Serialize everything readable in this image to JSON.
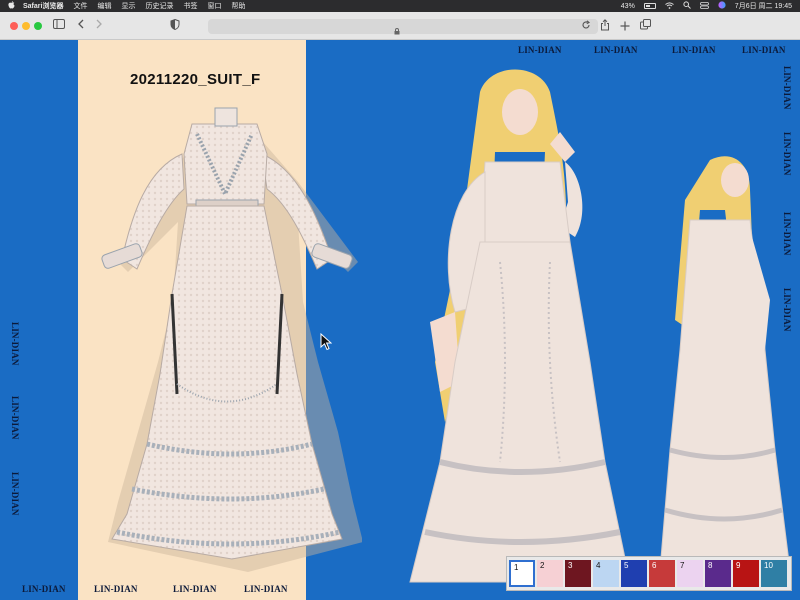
{
  "menubar": {
    "app_name": "Safari浏览器",
    "items": [
      "文件",
      "编辑",
      "显示",
      "历史记录",
      "书签",
      "窗口",
      "帮助"
    ],
    "battery": "43%",
    "datetime": "7月6日 周二 19:45",
    "icons": [
      "apple-icon",
      "battery-icon",
      "wifi-icon",
      "search-icon",
      "control-center-icon",
      "siri-icon"
    ]
  },
  "toolbar": {
    "icons": [
      "sidebar-icon",
      "back-icon",
      "forward-icon",
      "shield-icon",
      "lock-icon",
      "reload-icon",
      "share-icon",
      "new-tab-icon",
      "tabs-icon"
    ]
  },
  "content": {
    "suit_title": "20211220_SUIT_F",
    "watermark": "LIN-DIAN",
    "swatches": [
      {
        "label": "1",
        "color": "#ffffff"
      },
      {
        "label": "2",
        "color": "#f6d0d4"
      },
      {
        "label": "3",
        "color": "#6e1620"
      },
      {
        "label": "4",
        "color": "#bcd6f2"
      },
      {
        "label": "5",
        "color": "#1f3fb0"
      },
      {
        "label": "6",
        "color": "#c63a3a"
      },
      {
        "label": "7",
        "color": "#ecd3f0"
      },
      {
        "label": "8",
        "color": "#5a2a8c"
      },
      {
        "label": "9",
        "color": "#b81414"
      },
      {
        "label": "10",
        "color": "#2f7fa5"
      }
    ]
  },
  "colors": {
    "background_blue": "#1a6cc4",
    "panel_peach": "#fae3c4",
    "dress_ivory": "#efe3dc"
  }
}
